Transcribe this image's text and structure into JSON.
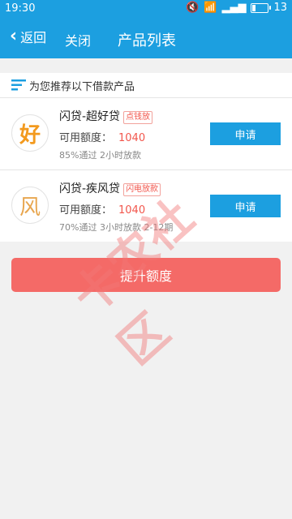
{
  "statusbar": {
    "time": "19:30",
    "battery": "13"
  },
  "header": {
    "back_label": "返回",
    "close_label": "关闭",
    "title": "产品列表"
  },
  "section": {
    "title": "为您推荐以下借款产品"
  },
  "products": [
    {
      "name": "闪贷-超好贷",
      "tag": "点钱放",
      "quota_label": "可用额度：",
      "quota_value": "1040",
      "meta": "85%通过  2小时放款",
      "logo_char": "好",
      "apply_label": "申请"
    },
    {
      "name": "闪贷-疾风贷",
      "tag": "闪电放款",
      "quota_label": "可用额度：",
      "quota_value": "1040",
      "meta": "70%通过  3小时放款  2-12期",
      "logo_char": "风",
      "apply_label": "申请"
    }
  ],
  "raise_button": "提升额度",
  "watermark": "卡农社区"
}
